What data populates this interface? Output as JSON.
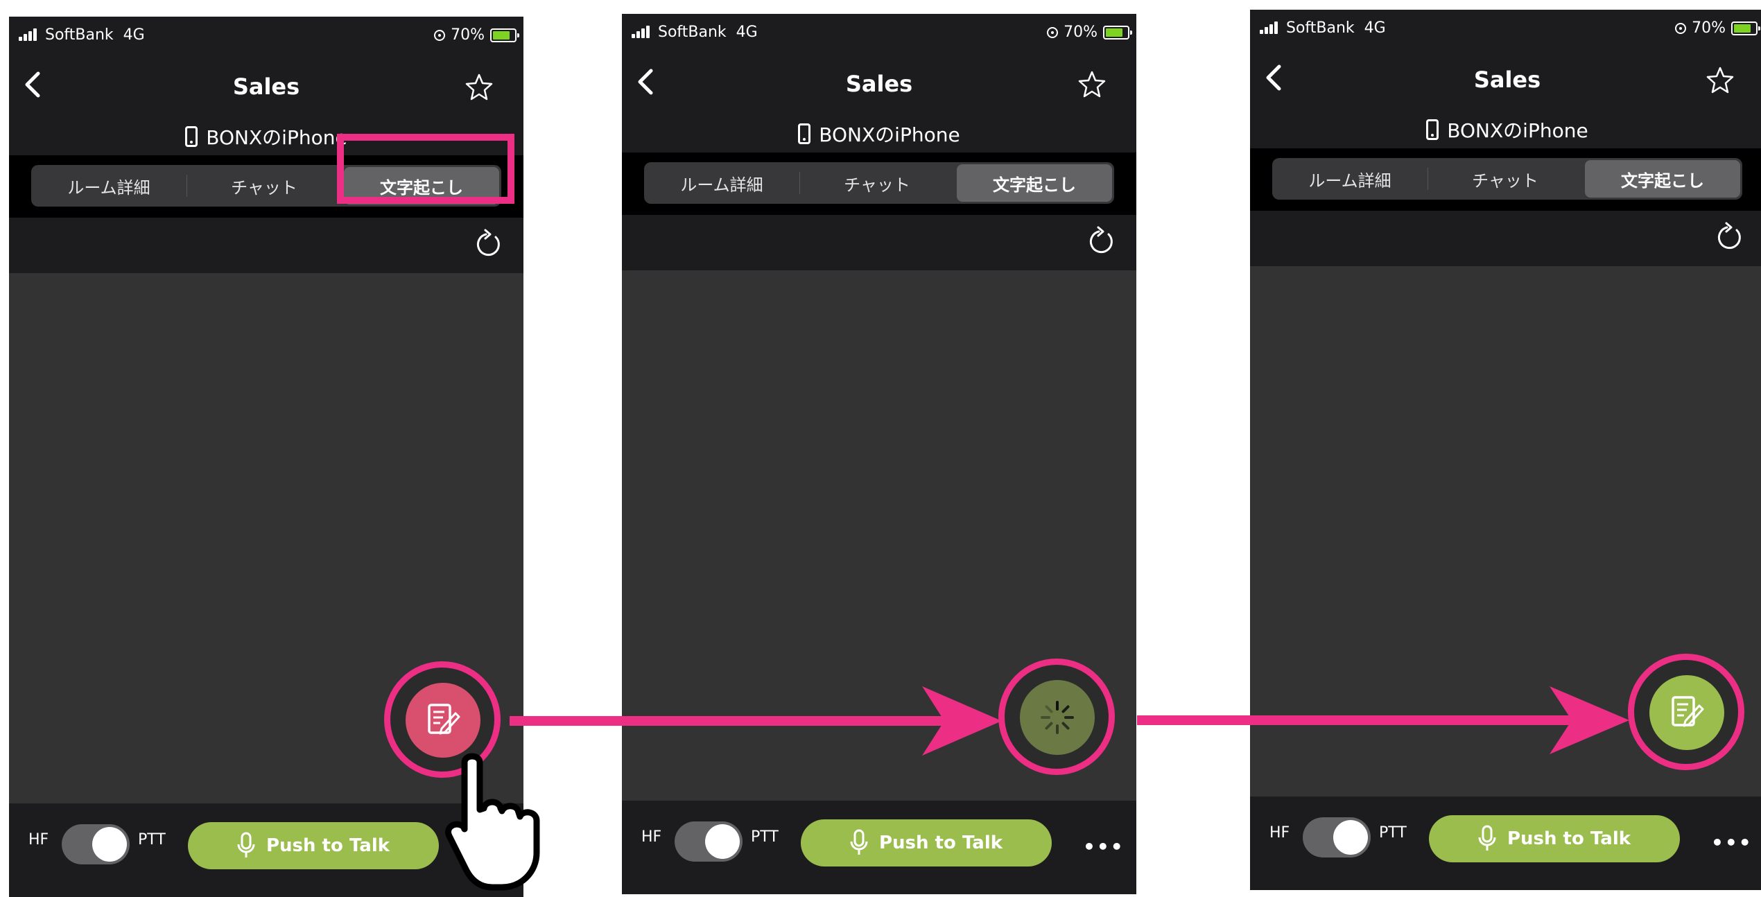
{
  "status_bar": {
    "carrier": "SoftBank",
    "network": "4G",
    "battery": "70%"
  },
  "nav": {
    "title": "Sales"
  },
  "device": {
    "name": "BONXのiPhone"
  },
  "tabs": [
    {
      "label": "ルーム詳細"
    },
    {
      "label": "チャット"
    },
    {
      "label": "文字起こし"
    }
  ],
  "active_tab": "文字起こし",
  "bottom_bar": {
    "hf_label": "HF",
    "ptt_label": "PTT",
    "push_to_talk_label": "Push to Talk",
    "more_label": "•••"
  },
  "transcribe_button_states": [
    {
      "state": "off",
      "color": "#d9506f"
    },
    {
      "state": "loading",
      "color": "#6b7a45"
    },
    {
      "state": "on",
      "color": "#9bbd4e"
    }
  ],
  "colors": {
    "highlight": "#ec2e85",
    "accent_green": "#9bbd4e",
    "dark_bar": "#1c1c1e",
    "content_bg": "#333333"
  },
  "icons": {
    "status": [
      "signal-icon",
      "orientation-lock-icon",
      "battery-icon"
    ],
    "nav": [
      "back-chevron-icon",
      "star-icon"
    ],
    "device": "iphone-icon",
    "toolbar": "refresh-icon",
    "bottom": [
      "microphone-icon",
      "more-icon"
    ],
    "fab": [
      "transcribe-memo-icon",
      "loading-spinner-icon"
    ],
    "annotation": [
      "pointing-hand-icon",
      "arrow-right-icon"
    ]
  }
}
